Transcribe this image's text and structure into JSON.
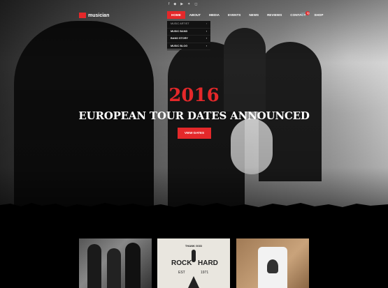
{
  "brand": {
    "name": "musician",
    "accent": "#e4282a"
  },
  "topbar": {
    "social_icons": [
      "facebook-icon",
      "vk-icon",
      "youtube-icon",
      "twitter-icon",
      "instagram-icon"
    ]
  },
  "nav": {
    "items": [
      "HOME",
      "ABOUT",
      "MEDIA",
      "EVENTS",
      "NEWS",
      "REVIEWS",
      "CONTACT",
      "SHOP"
    ],
    "active": "HOME",
    "cart_count": "0"
  },
  "dropdown": {
    "items": [
      "MUSIC ARTIST",
      "MUSIC BAND",
      "BAND STORY",
      "MUSIC BLOG"
    ]
  },
  "hero": {
    "year": "2016",
    "headline": "EUROPEAN TOUR DATES ANNOUNCED",
    "button": "VIEW DATES"
  },
  "thumbnails": {
    "rock_hard_top": "THANK GOD",
    "rock_hard_main_left": "ROCK",
    "rock_hard_main_right": "HARD",
    "rock_hard_bottom_left": "EST",
    "rock_hard_bottom_right": "1971"
  }
}
